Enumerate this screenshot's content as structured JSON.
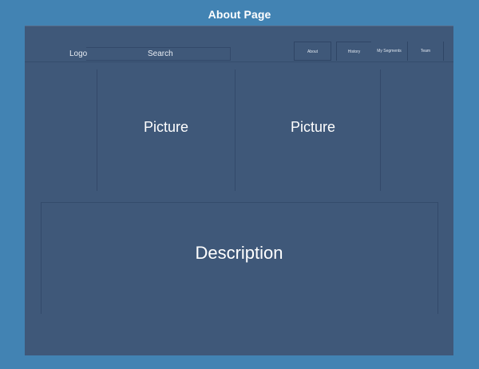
{
  "page": {
    "title": "About Page"
  },
  "header": {
    "logo_label": "Logo",
    "search_label": "Search",
    "nav": {
      "about": "About",
      "history": "History",
      "segments": "My Segments",
      "team": "Team"
    }
  },
  "main": {
    "picture_left_label": "Picture",
    "picture_right_label": "Picture",
    "description_label": "Description"
  },
  "colors": {
    "page_background": "#4283b3",
    "canvas_background": "#3f5879",
    "text": "#ffffff"
  }
}
